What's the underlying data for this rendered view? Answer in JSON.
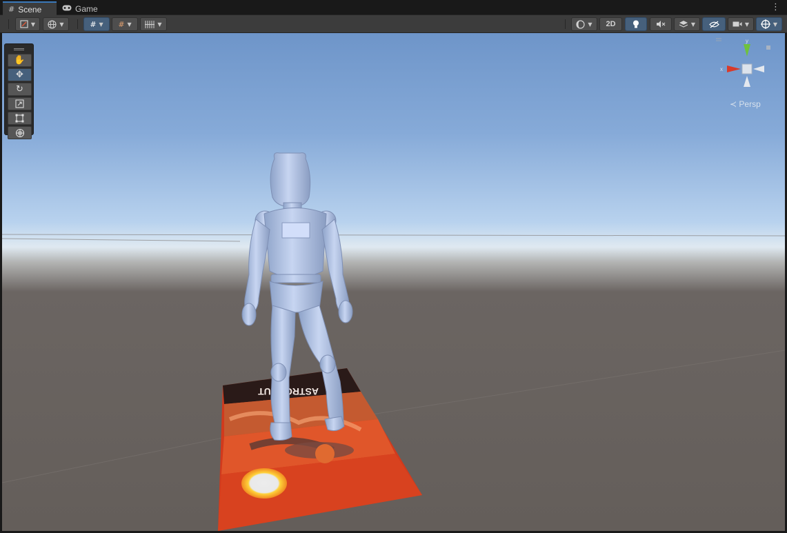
{
  "tabs": [
    {
      "label": "Scene",
      "icon": "grid-icon",
      "active": true
    },
    {
      "label": "Game",
      "icon": "gamepad-icon",
      "active": false
    }
  ],
  "toolbar": {
    "left_buttons": [
      "gizmo-draw-mode",
      "global-toggle",
      "grid-snap-toggle",
      "incremental-snap",
      "grid-visibility"
    ],
    "right_buttons": [
      "shading-mode",
      "2D",
      "lighting",
      "audio",
      "effects",
      "scene-visibility",
      "camera",
      "gizmos"
    ],
    "label_2d": "2D"
  },
  "tools": [
    "hand-tool",
    "move-tool",
    "rotate-tool",
    "scale-tool",
    "rect-tool",
    "transform-tool"
  ],
  "active_tool": "move-tool",
  "gizmo": {
    "label": "Persp",
    "axis_y": "y",
    "axis_x": "x"
  },
  "scene": {
    "objects": [
      "astronaut-character",
      "astronaut-poster-plane"
    ],
    "poster_text": "ASTRONAUT"
  },
  "colors": {
    "accent": "#3a79bb",
    "active_button": "#46607c",
    "sky_top": "#6e95c9",
    "ground": "#645e5a",
    "poster_red": "#d43a1c"
  }
}
